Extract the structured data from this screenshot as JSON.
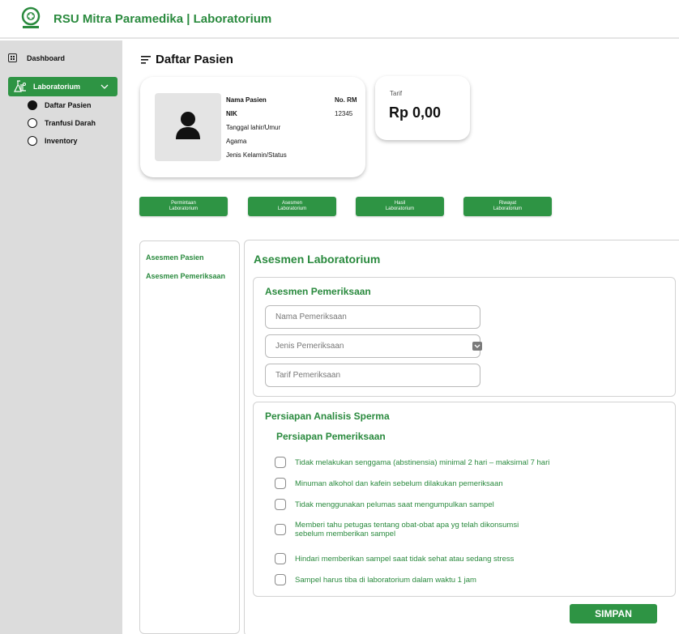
{
  "header": {
    "title": "RSU Mitra Paramedika | Laboratorium"
  },
  "sidebar": {
    "items": [
      {
        "label": "Dashboard"
      },
      {
        "label": "Laboratorium"
      }
    ],
    "sub_items": [
      {
        "label": "Daftar Pasien",
        "selected": true
      },
      {
        "label": "Tranfusi Darah",
        "selected": false
      },
      {
        "label": "Inventory",
        "selected": false
      }
    ]
  },
  "page": {
    "title": "Daftar Pasien"
  },
  "patient": {
    "name_label": "Nama Pasien",
    "nik_label": "NIK",
    "dob_label": "Tanggal lahir/Umur",
    "religion_label": "Agama",
    "gender_label": "Jenis Kelamin/Status",
    "rm_label": "No. RM",
    "rm_value": "12345"
  },
  "tarif": {
    "label": "Tarif",
    "value": "Rp 0,00"
  },
  "tabs": [
    {
      "line1": "Permintaan",
      "line2": "Laboratorium"
    },
    {
      "line1": "Asesmen",
      "line2": "Laboratorium"
    },
    {
      "line1": "Hasil",
      "line2": "Laboratorium"
    },
    {
      "line1": "Riwayat",
      "line2": "Laboratorium"
    }
  ],
  "leftnav": {
    "items": [
      {
        "label": "Asesmen Pasien"
      },
      {
        "label": "Asesmen Pemeriksaan"
      }
    ]
  },
  "main": {
    "title": "Asesmen Laboratorium",
    "section1": {
      "title": "Asesmen Pemeriksaan",
      "nama_placeholder": "Nama Pemeriksaan",
      "jenis_placeholder": "Jenis Pemeriksaan",
      "tarif_placeholder": "Tarif Pemeriksaan"
    },
    "section2": {
      "title": "Persiapan Analisis Sperma",
      "subtitle": "Persiapan Pemeriksaan",
      "items": [
        {
          "line1": "Tidak melakukan senggama (abstinensia) minimal 2 hari – maksimal 7 hari",
          "line2": "",
          "checked": false
        },
        {
          "line1": "Minuman alkohol dan kafein sebelum dilakukan pemeriksaan",
          "line2": "",
          "checked": false
        },
        {
          "line1": "Tidak menggunakan pelumas saat mengumpulkan sampel",
          "line2": "",
          "checked": false
        },
        {
          "line1": "Memberi tahu petugas tentang obat-obat apa yg telah dikonsumsi",
          "line2": "sebelum memberikan sampel",
          "checked": false
        },
        {
          "line1": "Hindari memberikan sampel saat tidak sehat atau sedang stress",
          "line2": "",
          "checked": false
        },
        {
          "line1": "Sampel harus tiba di laboratorium dalam waktu 1 jam",
          "line2": "",
          "checked": false
        }
      ]
    },
    "save_label": "SIMPAN"
  },
  "colors": {
    "accent": "#2e9444",
    "accent_text": "#2a8a3e",
    "sidebar_bg": "#dcdcdc"
  }
}
